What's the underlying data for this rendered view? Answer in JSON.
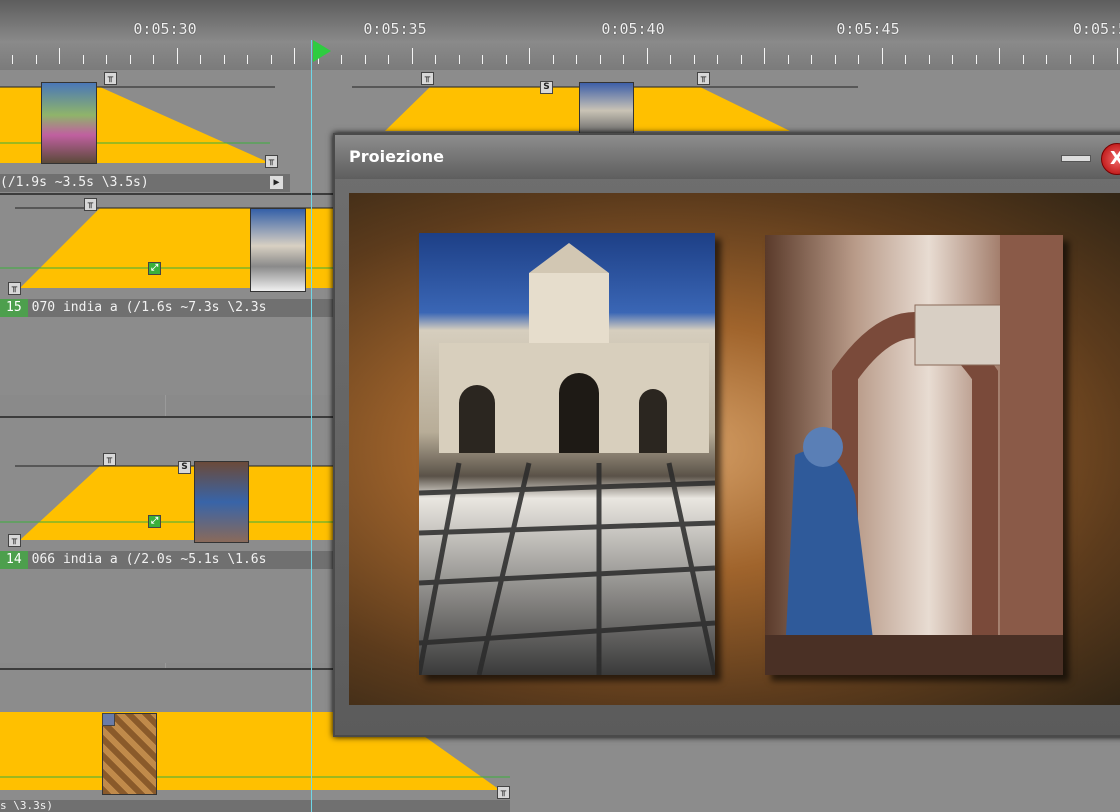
{
  "ruler": {
    "time_labels": [
      "0:05:30",
      "0:05:35",
      "0:05:40",
      "0:05:45",
      "0:05:5"
    ]
  },
  "tracks": {
    "track1_label": "(/1.9s ~3.5s \\3.5s)",
    "track2_number": "15",
    "track2_label": "070 india a (/1.6s ~7.3s \\2.3s",
    "track3_number": "14",
    "track3_label": "066 india a (/2.0s ~5.1s \\1.6s",
    "track4_label": "s \\3.3s)"
  },
  "preview": {
    "title": "Proiezione",
    "close_glyph": "X"
  },
  "colors": {
    "envelope": "#ffc000",
    "playhead": "#6fd6e8",
    "play_marker": "#2ecc40",
    "badge": "#4d9f4d"
  }
}
